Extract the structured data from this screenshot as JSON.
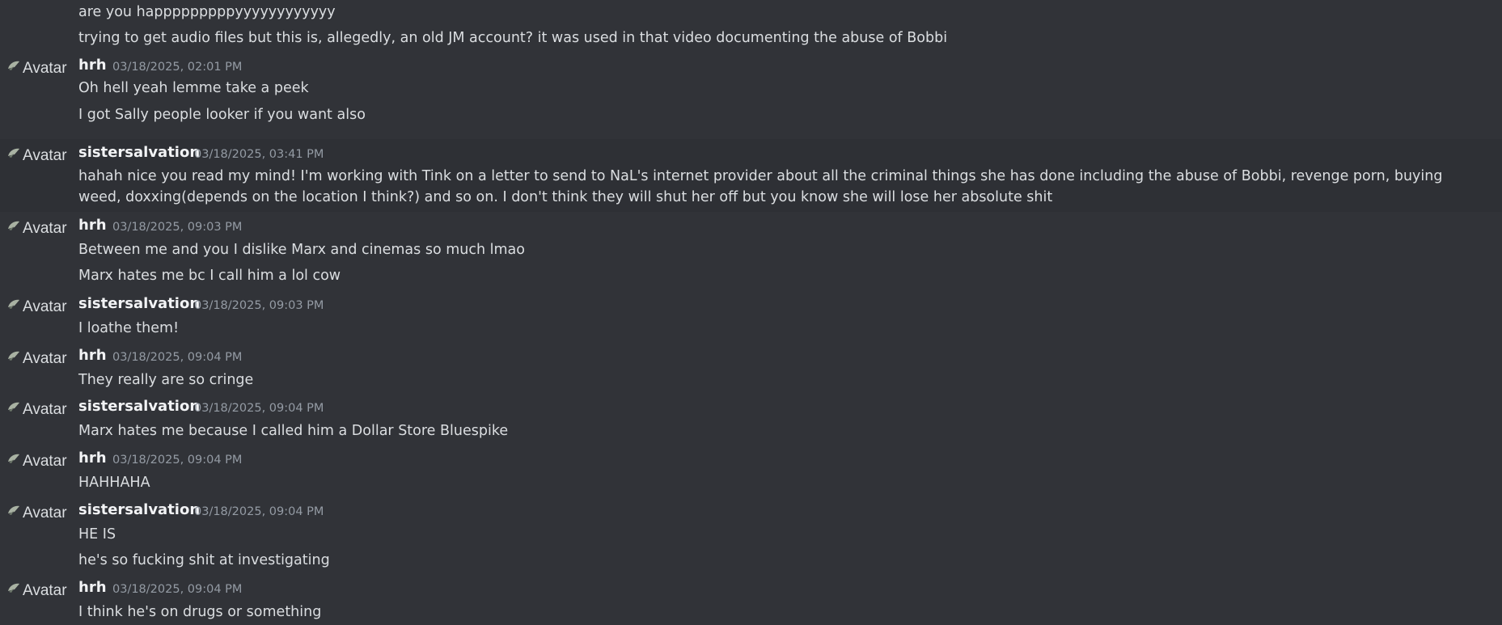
{
  "avatar_alt": "Avatar",
  "messages": [
    {
      "lines": [
        "are you happpppppppyyyyyyyyyyyy",
        "trying to get audio files but this is, allegedly, an old JM account? it was used in that video documenting the abuse of Bobbi"
      ]
    },
    {
      "username": "hrh",
      "timestamp": "03/18/2025, 02:01 PM",
      "lines": [
        "Oh hell yeah lemme take a peek",
        "I got Sally people looker if you want also"
      ]
    },
    {
      "username": "sistersalvation",
      "timestamp": "03/18/2025, 03:41 PM",
      "lines": [
        "hahah nice you read my mind! I'm working with Tink on a letter to send to NaL's internet provider about all the criminal things she has done including the abuse of Bobbi, revenge porn, buying weed, doxxing(depends on the location I think?) and so on. I don't think they will shut her off but you know she will lose her absolute shit"
      ]
    },
    {
      "username": "hrh",
      "timestamp": "03/18/2025, 09:03 PM",
      "lines": [
        "Between me and you I dislike Marx and cinemas so much lmao",
        "Marx hates me bc I call him a lol cow"
      ]
    },
    {
      "username": "sistersalvation",
      "timestamp": "03/18/2025, 09:03 PM",
      "lines": [
        "I loathe them!"
      ]
    },
    {
      "username": "hrh",
      "timestamp": "03/18/2025, 09:04 PM",
      "lines": [
        "They really are so cringe"
      ]
    },
    {
      "username": "sistersalvation",
      "timestamp": "03/18/2025, 09:04 PM",
      "lines": [
        "Marx hates me because I called him a Dollar Store Bluespike"
      ]
    },
    {
      "username": "hrh",
      "timestamp": "03/18/2025, 09:04 PM",
      "lines": [
        "HAHHAHA"
      ]
    },
    {
      "username": "sistersalvation",
      "timestamp": "03/18/2025, 09:04 PM",
      "lines": [
        "HE IS",
        "he's so fucking shit at investigating"
      ]
    },
    {
      "username": "hrh",
      "timestamp": "03/18/2025, 09:04 PM",
      "lines": [
        "I think he's on drugs or something"
      ]
    }
  ]
}
